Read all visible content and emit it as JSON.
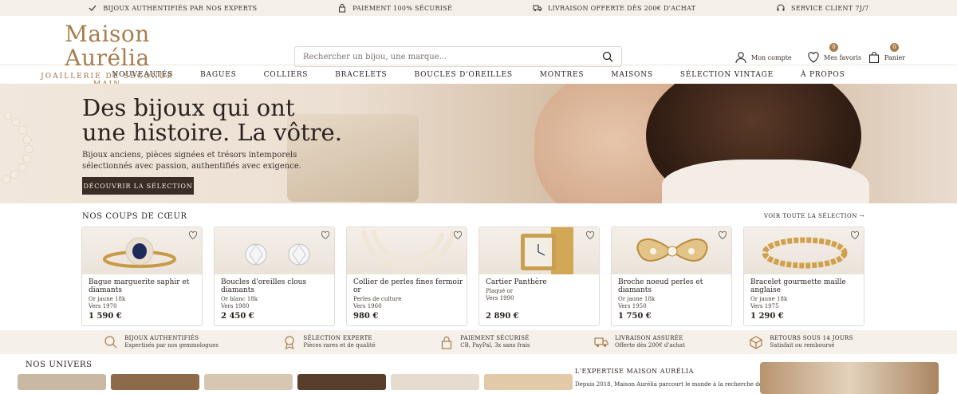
{
  "topbar": [
    {
      "icon": "check-icon",
      "label": "BIJOUX AUTHENTIFIÉS PAR NOS EXPERTS"
    },
    {
      "icon": "lock-icon",
      "label": "PAIEMENT 100% SÉCURISÉ"
    },
    {
      "icon": "truck-icon",
      "label": "LIVRAISON OFFERTE DÈS 200€ D'ACHAT"
    },
    {
      "icon": "headset-icon",
      "label": "SERVICE CLIENT 7J/7"
    }
  ],
  "logo": {
    "name": "Maison Aurélia",
    "tagline": "JOAILLERIE DE SECONDE MAIN"
  },
  "search": {
    "placeholder": "Rechercher un bijou, une marque..."
  },
  "account": {
    "label": "Mon compte"
  },
  "favorites": {
    "label": "Mes favoris",
    "count": "0"
  },
  "cart": {
    "label": "Panier",
    "count": "0"
  },
  "nav": [
    "NOUVEAUTÉS",
    "BAGUES",
    "COLLIERS",
    "BRACELETS",
    "BOUCLES D'OREILLES",
    "MONTRES",
    "MAISONS",
    "SÉLECTION VINTAGE",
    "À PROPOS"
  ],
  "hero": {
    "title1": "Des bijoux qui ont",
    "title2": "une histoire. La vôtre.",
    "text1": "Bijoux anciens, pièces signées et trésors intemporels",
    "text2": "sélectionnés avec passion, authentifiés avec exigence.",
    "button": "DÉCOUVRIR LA SÉLECTION"
  },
  "favs": {
    "heading": "NOS COUPS DE CŒUR",
    "link": "VOIR TOUTE LA SÉLECTION"
  },
  "products": [
    {
      "title": "Bague marguerite saphir et diamants",
      "metal": "Or jaune 18k",
      "era": "Vers 1970",
      "price": "1 590 €"
    },
    {
      "title": "Boucles d'oreilles clous diamants",
      "metal": "Or blanc 18k",
      "era": "Vers 1980",
      "price": "2 450 €"
    },
    {
      "title": "Collier de perles fines fermoir or",
      "metal": "Perles de culture",
      "era": "Vers 1960",
      "price": "980 €"
    },
    {
      "title": "Cartier Panthère",
      "metal": "Plaqué or",
      "era": "Vers 1990",
      "price": "2 890 €"
    },
    {
      "title": "Broche noeud perles et diamants",
      "metal": "Or jaune 18k",
      "era": "Vers 1950",
      "price": "1 750 €"
    },
    {
      "title": "Bracelet gourmette maille anglaise",
      "metal": "Or jaune 18k",
      "era": "Vers 1975",
      "price": "1 290 €"
    }
  ],
  "ribbon": [
    {
      "icon": "magnifier-icon",
      "title": "BIJOUX AUTHENTIFIÉS",
      "text": "Expertisés par nos gemmologues"
    },
    {
      "icon": "award-icon",
      "title": "SÉLECTION EXPERTE",
      "text": "Pièces rares et de qualité"
    },
    {
      "icon": "lock-icon",
      "title": "PAIEMENT SÉCURISÉ",
      "text": "CB, PayPal, 3x sans frais"
    },
    {
      "icon": "truck-icon",
      "title": "LIVRAISON ASSURÉE",
      "text": "Offerte dès 200€ d'achat"
    },
    {
      "icon": "box-icon",
      "title": "RETOURS SOUS 14 JOURS",
      "text": "Satisfait ou remboursé"
    }
  ],
  "universe": {
    "heading": "NOS UNIVERS"
  },
  "expertise": {
    "heading": "L'EXPERTISE MAISON AURÉLIA",
    "text": "Depuis 2018, Maison Aurélia parcourt le monde à la recherche de bijoux"
  }
}
